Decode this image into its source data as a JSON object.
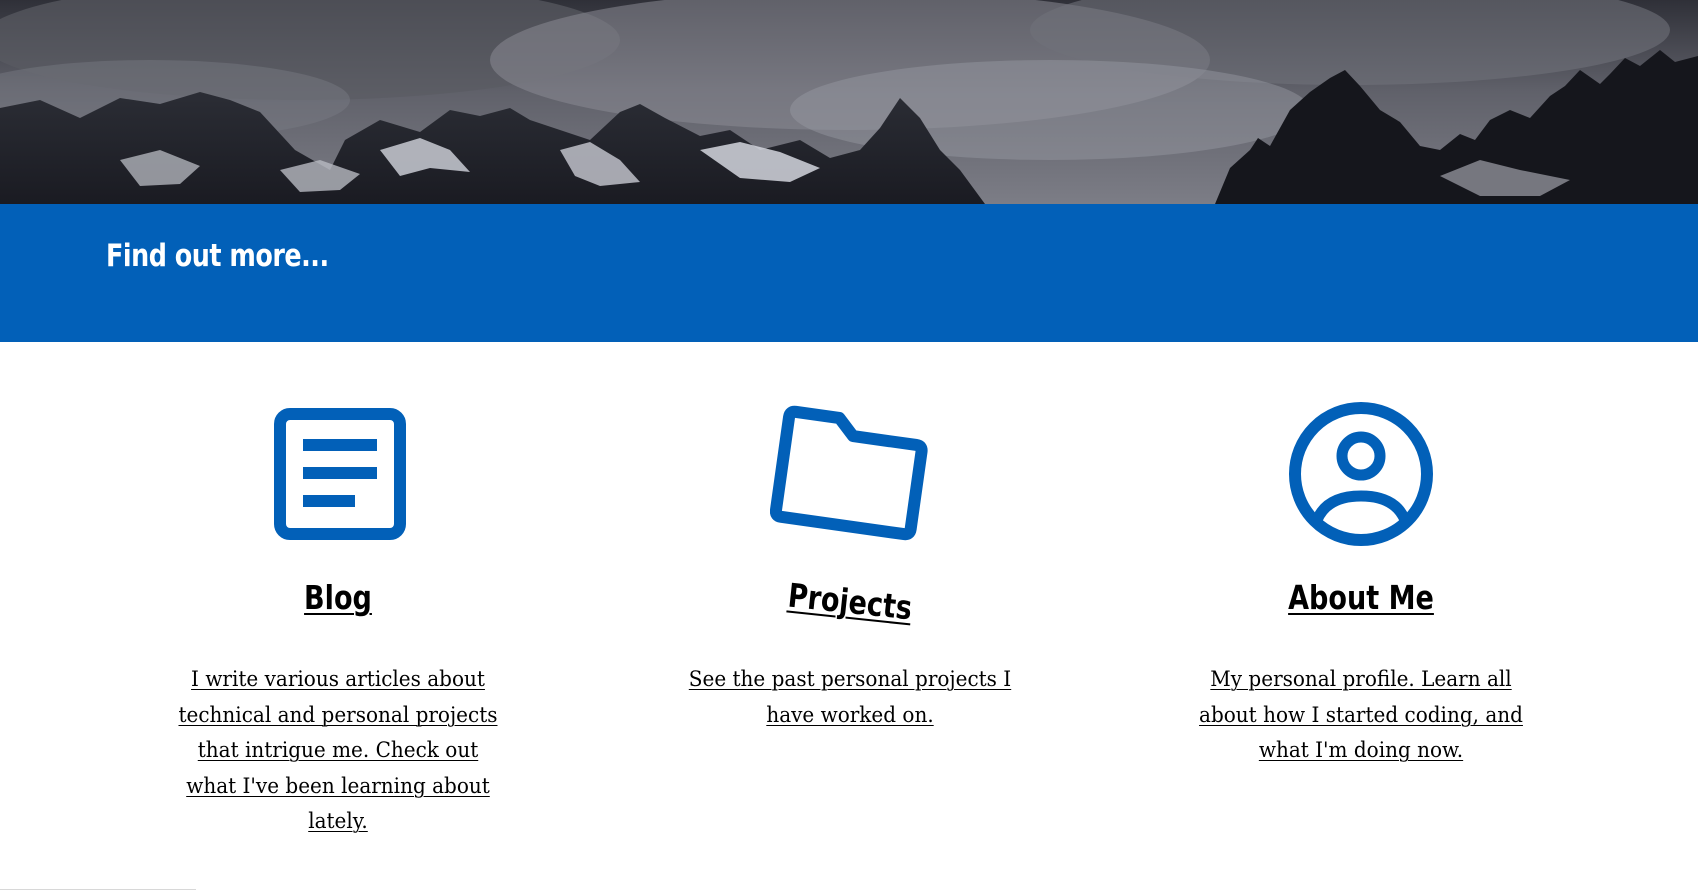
{
  "hero": {
    "image_alt": "mountain range banner"
  },
  "band": {
    "title": "Find out more..."
  },
  "cards": [
    {
      "icon": "document-icon",
      "heading": "Blog",
      "description": "I write various articles about technical and personal projects that intrigue me. Check out what I've been learning about lately."
    },
    {
      "icon": "folder-icon",
      "heading": "Projects",
      "description": "See the past personal projects I have worked on."
    },
    {
      "icon": "user-profile-icon",
      "heading": "About Me",
      "description": "My personal profile. Learn all about how I started coding, and what I'm doing now."
    }
  ],
  "colors": {
    "accent": "#0260b8",
    "text": "#000000",
    "background": "#ffffff"
  }
}
